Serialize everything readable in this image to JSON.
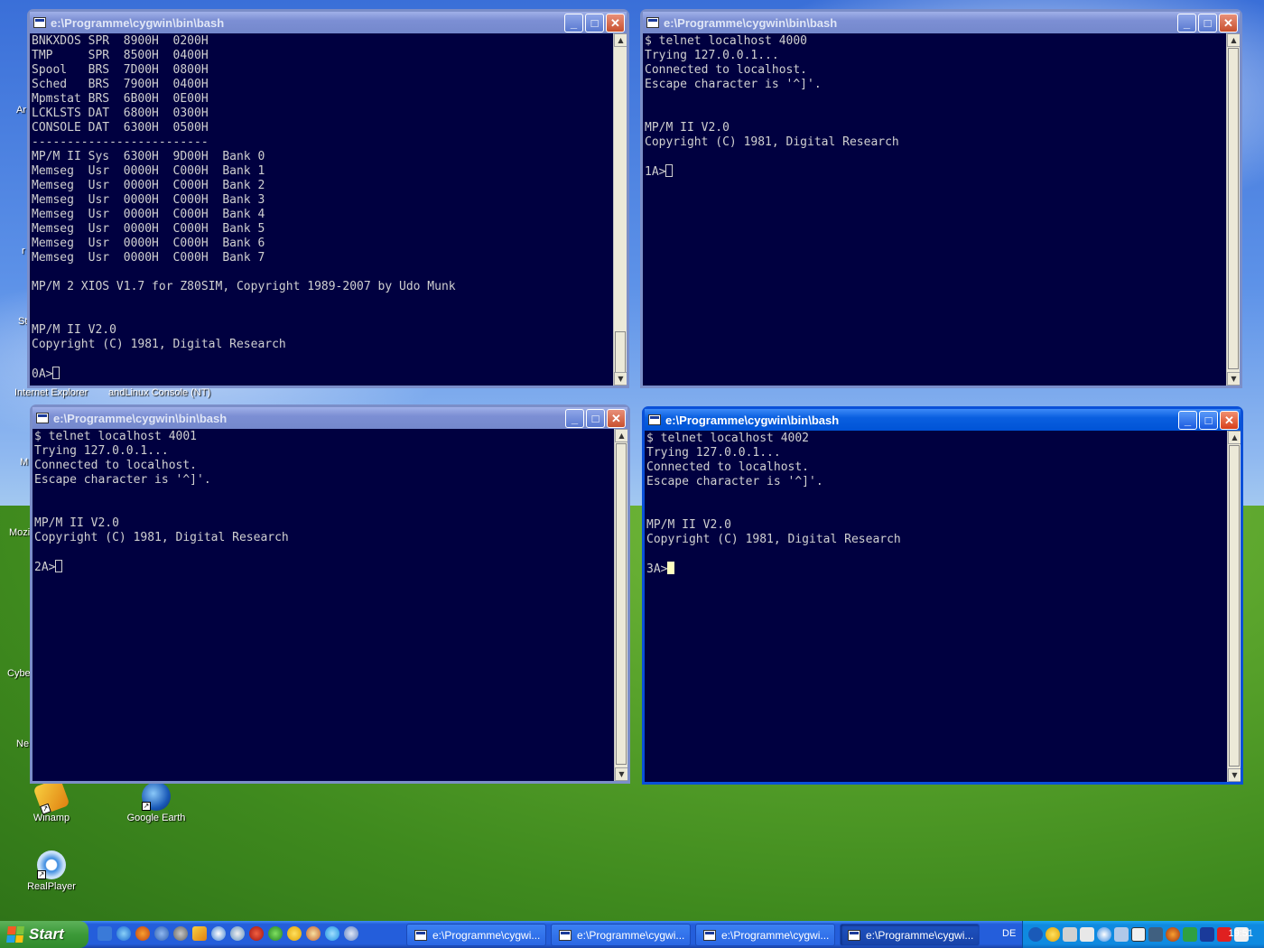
{
  "desktop": {
    "edge_labels": [
      "Ar",
      "r",
      "St",
      "M",
      "Mozi",
      "Cybe",
      "Ne"
    ],
    "mid_labels": {
      "internet_explorer": "Internet Explorer",
      "andlinux": "andLinux Console (NT)"
    },
    "icons": [
      {
        "label": "Winamp",
        "icon": "winamp-icon"
      },
      {
        "label": "Google Earth",
        "icon": "google-earth-icon"
      },
      {
        "label": "RealPlayer",
        "icon": "realplayer-icon"
      }
    ]
  },
  "windows": [
    {
      "title": "e:\\Programme\\cygwin\\bin\\bash",
      "active": false,
      "lines": [
        "BNKXDOS SPR  8900H  0200H",
        "TMP     SPR  8500H  0400H",
        "Spool   BRS  7D00H  0800H",
        "Sched   BRS  7900H  0400H",
        "Mpmstat BRS  6B00H  0E00H",
        "LCKLSTS DAT  6800H  0300H",
        "CONSOLE DAT  6300H  0500H",
        "-------------------------",
        "MP/M II Sys  6300H  9D00H  Bank 0",
        "Memseg  Usr  0000H  C000H  Bank 1",
        "Memseg  Usr  0000H  C000H  Bank 2",
        "Memseg  Usr  0000H  C000H  Bank 3",
        "Memseg  Usr  0000H  C000H  Bank 4",
        "Memseg  Usr  0000H  C000H  Bank 5",
        "Memseg  Usr  0000H  C000H  Bank 6",
        "Memseg  Usr  0000H  C000H  Bank 7",
        "",
        "MP/M 2 XIOS V1.7 for Z80SIM, Copyright 1989-2007 by Udo Munk",
        "",
        "",
        "MP/M II V2.0",
        "Copyright (C) 1981, Digital Research",
        ""
      ],
      "prompt": "0A>"
    },
    {
      "title": "e:\\Programme\\cygwin\\bin\\bash",
      "active": false,
      "lines": [
        "$ telnet localhost 4000",
        "Trying 127.0.0.1...",
        "Connected to localhost.",
        "Escape character is '^]'.",
        "",
        "",
        "MP/M II V2.0",
        "Copyright (C) 1981, Digital Research",
        ""
      ],
      "prompt": "1A>"
    },
    {
      "title": "e:\\Programme\\cygwin\\bin\\bash",
      "active": false,
      "lines": [
        "$ telnet localhost 4001",
        "Trying 127.0.0.1...",
        "Connected to localhost.",
        "Escape character is '^]'.",
        "",
        "",
        "MP/M II V2.0",
        "Copyright (C) 1981, Digital Research",
        ""
      ],
      "prompt": "2A>"
    },
    {
      "title": "e:\\Programme\\cygwin\\bin\\bash",
      "active": true,
      "lines": [
        "$ telnet localhost 4002",
        "Trying 127.0.0.1...",
        "Connected to localhost.",
        "Escape character is '^]'.",
        "",
        "",
        "MP/M II V2.0",
        "Copyright (C) 1981, Digital Research",
        ""
      ],
      "prompt": "3A>"
    }
  ],
  "taskbar": {
    "start_label": "Start",
    "quick_launch": [
      "outlook-icon",
      "ie-icon",
      "firefox-icon",
      "thunderbird-icon",
      "misc-icon",
      "winamp-icon",
      "media-icon",
      "chat-icon",
      "opera-icon",
      "icq-icon",
      "messenger-icon",
      "tool-icon",
      "skype-icon",
      "shortcut-icon"
    ],
    "tasks": [
      {
        "label": "e:\\Programme\\cygwi...",
        "active": false
      },
      {
        "label": "e:\\Programme\\cygwi...",
        "active": false
      },
      {
        "label": "e:\\Programme\\cygwi...",
        "active": false
      },
      {
        "label": "e:\\Programme\\cygwi...",
        "active": true
      }
    ],
    "language": "DE",
    "clock": "19:51"
  }
}
